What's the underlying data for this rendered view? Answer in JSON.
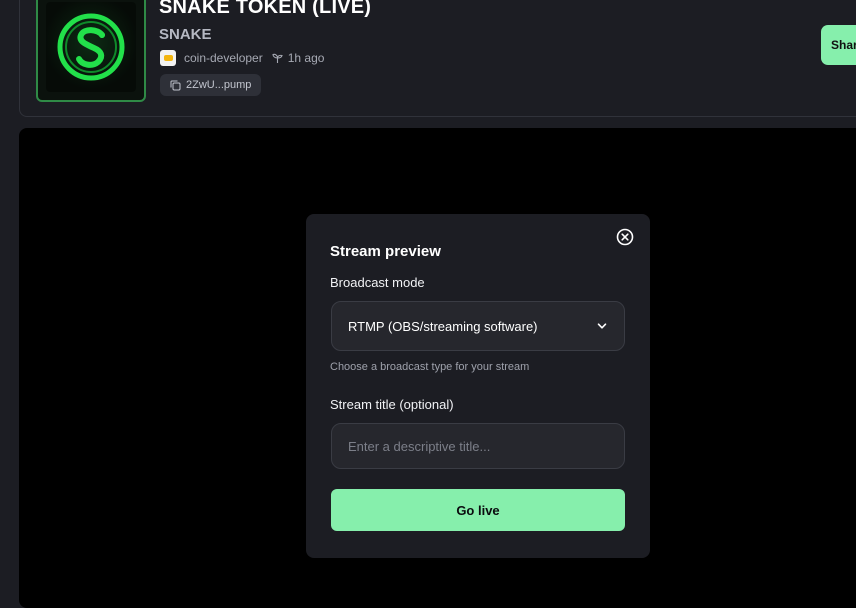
{
  "coin": {
    "name": "SNAKE TOKEN (LIVE)",
    "ticker": "SNAKE",
    "creator": "coin-developer",
    "age": "1h ago",
    "contract_short": "2ZwU...pump",
    "avatar_icon": "snake-s-logo",
    "share_label": "Share"
  },
  "modal": {
    "title": "Stream preview",
    "broadcast_label": "Broadcast mode",
    "broadcast_value": "RTMP (OBS/streaming software)",
    "broadcast_helper": "Choose a broadcast type for your stream",
    "stream_title_label": "Stream title (optional)",
    "stream_title_placeholder": "Enter a descriptive title...",
    "stream_title_value": "",
    "go_live_label": "Go live",
    "close_icon": "close-circle-icon"
  },
  "colors": {
    "accent": "#86efac",
    "background": "#1c1d23",
    "stream_bg": "#000000",
    "logo_green": "#22e04a"
  }
}
